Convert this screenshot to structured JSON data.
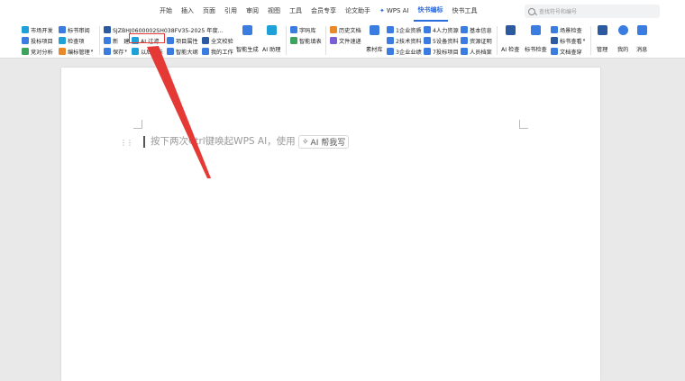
{
  "tabs": [
    "开始",
    "插入",
    "页面",
    "引用",
    "审阅",
    "视图",
    "工具",
    "会员专享",
    "论文助手",
    "WPS AI",
    "快书编标",
    "快书工具"
  ],
  "active_tab": "快书编标",
  "search": {
    "placeholder": "查找符号和编号"
  },
  "ribbon": {
    "g1": [
      "市场开发",
      "投标项目",
      "竞对分析"
    ],
    "g2": [
      "标书审阅",
      "检查项",
      "编标管理"
    ],
    "project_name": "SJZBHJ0600002SH038FV35-2025 年度…",
    "new_label": "新",
    "build_label": "建",
    "save_label": "保存",
    "ai_filter": "AI 过滤",
    "history_label": "以后律标",
    "project_props": "项目属性",
    "smart_outline": "智能大纲",
    "my_work": "我的工作",
    "full_check": "全文校验",
    "smart_gen": "智能生成",
    "ai_assistant": "AI 助理",
    "word_lib": "字码库",
    "smart_tables": "智能填表",
    "history_docs": "历史文档",
    "file_transfer": "文件速递",
    "material_lib": "素材库",
    "numbered": [
      "1企业资质",
      "2技术资料",
      "3企业业绩",
      "4人力资源",
      "5设备资料",
      "7投标项目"
    ],
    "info": [
      "基本信息",
      "资源证明",
      "人员档案"
    ],
    "ai_check": "AI 检查",
    "bid_check": "标书检查",
    "scenario_check": "场景检查",
    "bid_view": "标书查看",
    "doc_search": "文档查穿",
    "manage": "管理",
    "mine": "我的",
    "messages": "消息"
  },
  "document": {
    "hint": "按下两次Ctrl键唤起WPS AI，使用",
    "ai_help_label": "AI 帮我写"
  },
  "colors": {
    "accent": "#2b6be0",
    "annotation": "#e53935"
  }
}
